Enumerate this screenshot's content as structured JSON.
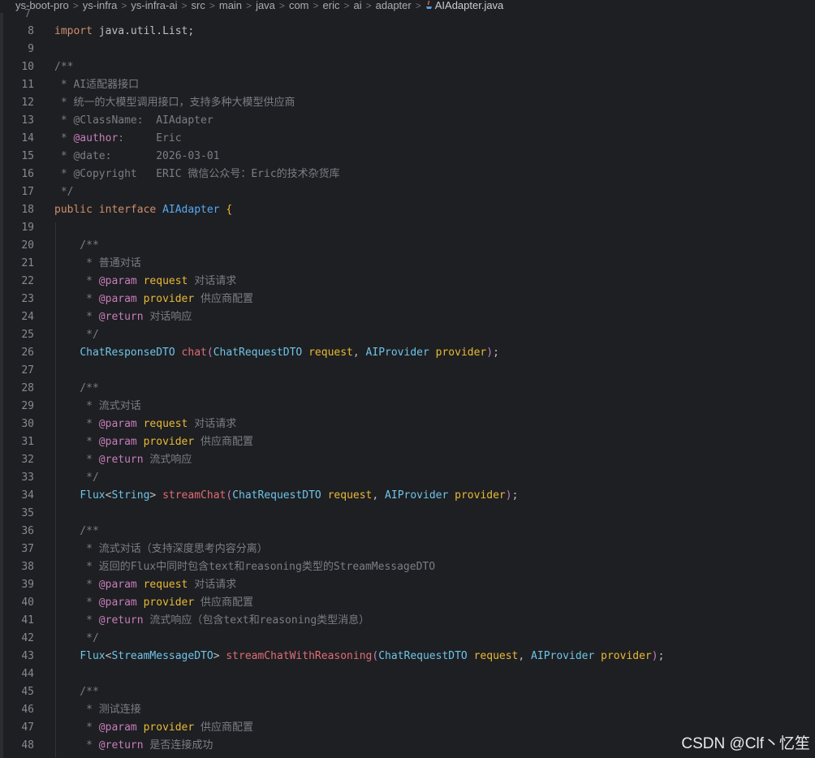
{
  "breadcrumb": {
    "items": [
      "ys-boot-pro",
      "ys-infra",
      "ys-infra-ai",
      "src",
      "main",
      "java",
      "com",
      "eric",
      "ai",
      "adapter"
    ],
    "file": "AIAdapter.java",
    "separator": ">"
  },
  "gutter_top": "7",
  "lines": [
    {
      "n": "8",
      "parts": [
        [
          "kw",
          "import "
        ],
        [
          "pl",
          "java.util.List;"
        ]
      ]
    },
    {
      "n": "9",
      "parts": []
    },
    {
      "n": "10",
      "parts": [
        [
          "cm",
          "/**"
        ]
      ]
    },
    {
      "n": "11",
      "parts": [
        [
          "cm",
          " * AI适配器接口"
        ]
      ]
    },
    {
      "n": "12",
      "parts": [
        [
          "cm",
          " * 统一的大模型调用接口，支持多种大模型供应商"
        ]
      ]
    },
    {
      "n": "13",
      "parts": [
        [
          "cm",
          " * @ClassName:  AIAdapter"
        ]
      ]
    },
    {
      "n": "14",
      "parts": [
        [
          "cm",
          " * "
        ],
        [
          "tag",
          "@author"
        ],
        [
          "cm",
          ":     Eric"
        ]
      ]
    },
    {
      "n": "15",
      "parts": [
        [
          "cm",
          " * @date:       2026-03-01"
        ]
      ]
    },
    {
      "n": "16",
      "parts": [
        [
          "cm",
          " * @Copyright   ERIC 微信公众号：Eric的技术杂货库"
        ]
      ]
    },
    {
      "n": "17",
      "parts": [
        [
          "cm",
          " */"
        ]
      ]
    },
    {
      "n": "18",
      "parts": [
        [
          "kw",
          "public interface "
        ],
        [
          "fn",
          "AIAdapter "
        ],
        [
          "br",
          "{"
        ]
      ]
    },
    {
      "n": "19",
      "parts": []
    },
    {
      "n": "20",
      "parts": [
        [
          "cm",
          "    /**"
        ]
      ]
    },
    {
      "n": "21",
      "parts": [
        [
          "cm",
          "     * 普通对话"
        ]
      ]
    },
    {
      "n": "22",
      "parts": [
        [
          "cm",
          "     * "
        ],
        [
          "tag",
          "@param "
        ],
        [
          "pn",
          "request "
        ],
        [
          "cm",
          "对话请求"
        ]
      ]
    },
    {
      "n": "23",
      "parts": [
        [
          "cm",
          "     * "
        ],
        [
          "tag",
          "@param "
        ],
        [
          "pn",
          "provider "
        ],
        [
          "cm",
          "供应商配置"
        ]
      ]
    },
    {
      "n": "24",
      "parts": [
        [
          "cm",
          "     * "
        ],
        [
          "tag",
          "@return "
        ],
        [
          "cm",
          "对话响应"
        ]
      ]
    },
    {
      "n": "25",
      "parts": [
        [
          "cm",
          "     */"
        ]
      ]
    },
    {
      "n": "26",
      "parts": [
        [
          "pl",
          "    "
        ],
        [
          "tp",
          "ChatResponseDTO "
        ],
        [
          "mn",
          "chat"
        ],
        [
          "kw2",
          "("
        ],
        [
          "tp",
          "ChatRequestDTO "
        ],
        [
          "pn",
          "request"
        ],
        [
          "pl",
          ", "
        ],
        [
          "tp",
          "AIProvider "
        ],
        [
          "pn",
          "provider"
        ],
        [
          "kw2",
          ")"
        ],
        [
          "pl",
          ";"
        ]
      ]
    },
    {
      "n": "27",
      "parts": []
    },
    {
      "n": "28",
      "parts": [
        [
          "cm",
          "    /**"
        ]
      ]
    },
    {
      "n": "29",
      "parts": [
        [
          "cm",
          "     * 流式对话"
        ]
      ]
    },
    {
      "n": "30",
      "parts": [
        [
          "cm",
          "     * "
        ],
        [
          "tag",
          "@param "
        ],
        [
          "pn",
          "request "
        ],
        [
          "cm",
          "对话请求"
        ]
      ]
    },
    {
      "n": "31",
      "parts": [
        [
          "cm",
          "     * "
        ],
        [
          "tag",
          "@param "
        ],
        [
          "pn",
          "provider "
        ],
        [
          "cm",
          "供应商配置"
        ]
      ]
    },
    {
      "n": "32",
      "parts": [
        [
          "cm",
          "     * "
        ],
        [
          "tag",
          "@return "
        ],
        [
          "cm",
          "流式响应"
        ]
      ]
    },
    {
      "n": "33",
      "parts": [
        [
          "cm",
          "     */"
        ]
      ]
    },
    {
      "n": "34",
      "parts": [
        [
          "pl",
          "    "
        ],
        [
          "tp",
          "Flux"
        ],
        [
          "pl",
          "<"
        ],
        [
          "tp",
          "String"
        ],
        [
          "pl",
          "> "
        ],
        [
          "mn",
          "streamChat"
        ],
        [
          "kw2",
          "("
        ],
        [
          "tp",
          "ChatRequestDTO "
        ],
        [
          "pn",
          "request"
        ],
        [
          "pl",
          ", "
        ],
        [
          "tp",
          "AIProvider "
        ],
        [
          "pn",
          "provider"
        ],
        [
          "kw2",
          ")"
        ],
        [
          "pl",
          ";"
        ]
      ]
    },
    {
      "n": "35",
      "parts": []
    },
    {
      "n": "36",
      "parts": [
        [
          "cm",
          "    /**"
        ]
      ]
    },
    {
      "n": "37",
      "parts": [
        [
          "cm",
          "     * 流式对话（支持深度思考内容分离）"
        ]
      ]
    },
    {
      "n": "38",
      "parts": [
        [
          "cm",
          "     * 返回的Flux中同时包含text和reasoning类型的StreamMessageDTO"
        ]
      ]
    },
    {
      "n": "39",
      "parts": [
        [
          "cm",
          "     * "
        ],
        [
          "tag",
          "@param "
        ],
        [
          "pn",
          "request "
        ],
        [
          "cm",
          "对话请求"
        ]
      ]
    },
    {
      "n": "40",
      "parts": [
        [
          "cm",
          "     * "
        ],
        [
          "tag",
          "@param "
        ],
        [
          "pn",
          "provider "
        ],
        [
          "cm",
          "供应商配置"
        ]
      ]
    },
    {
      "n": "41",
      "parts": [
        [
          "cm",
          "     * "
        ],
        [
          "tag",
          "@return "
        ],
        [
          "cm",
          "流式响应（包含text和reasoning类型消息）"
        ]
      ]
    },
    {
      "n": "42",
      "parts": [
        [
          "cm",
          "     */"
        ]
      ]
    },
    {
      "n": "43",
      "parts": [
        [
          "pl",
          "    "
        ],
        [
          "tp",
          "Flux"
        ],
        [
          "pl",
          "<"
        ],
        [
          "tp",
          "StreamMessageDTO"
        ],
        [
          "pl",
          "> "
        ],
        [
          "mn",
          "streamChatWithReasoning"
        ],
        [
          "kw2",
          "("
        ],
        [
          "tp",
          "ChatRequestDTO "
        ],
        [
          "pn",
          "request"
        ],
        [
          "pl",
          ", "
        ],
        [
          "tp",
          "AIProvider "
        ],
        [
          "pn",
          "provider"
        ],
        [
          "kw2",
          ")"
        ],
        [
          "pl",
          ";"
        ]
      ]
    },
    {
      "n": "44",
      "parts": []
    },
    {
      "n": "45",
      "parts": [
        [
          "cm",
          "    /**"
        ]
      ]
    },
    {
      "n": "46",
      "parts": [
        [
          "cm",
          "     * 测试连接"
        ]
      ]
    },
    {
      "n": "47",
      "parts": [
        [
          "cm",
          "     * "
        ],
        [
          "tag",
          "@param "
        ],
        [
          "pn",
          "provider "
        ],
        [
          "cm",
          "供应商配置"
        ]
      ]
    },
    {
      "n": "48",
      "parts": [
        [
          "cm",
          "     * "
        ],
        [
          "tag",
          "@return "
        ],
        [
          "cm",
          "是否连接成功"
        ]
      ]
    }
  ],
  "watermark": "CSDN @Clf丶忆笙"
}
